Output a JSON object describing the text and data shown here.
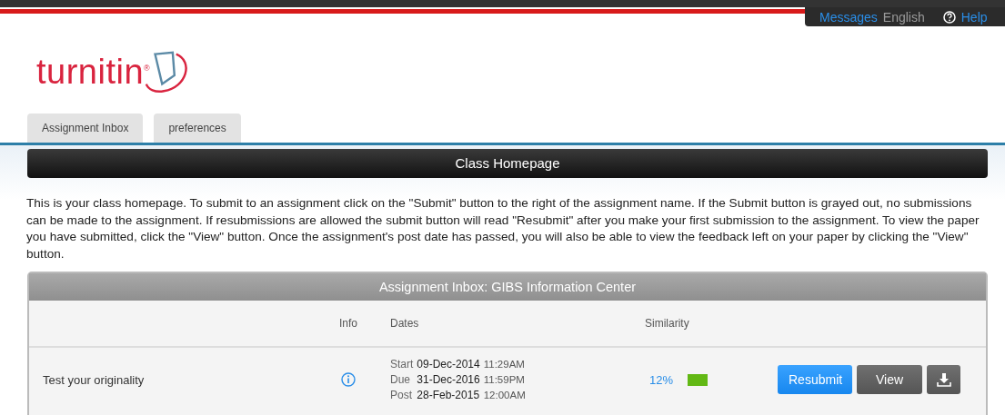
{
  "top_bar": {
    "links": [
      {
        "label": "Messages",
        "kind": "link"
      },
      {
        "label": "English",
        "kind": "text"
      },
      {
        "label": "Help",
        "kind": "help"
      }
    ]
  },
  "logo": {
    "text": "turnitin",
    "mark": "®"
  },
  "tabs": [
    {
      "label": "Assignment Inbox",
      "selected": false
    },
    {
      "label": "preferences",
      "selected": false
    }
  ],
  "page_title": "Class Homepage",
  "intro": "This is your class homepage. To submit to an assignment click on the \"Submit\" button to the right of the assignment name. If the Submit button is grayed out, no submissions can be made to the assignment. If resubmissions are allowed the submit button will read \"Resubmit\" after you make your first submission to the assignment. To view the paper you have submitted, click the \"View\" button. Once the assignment's post date has passed, you will also be able to view the feedback left on your paper by clicking the \"View\" button.",
  "inbox": {
    "title": "Assignment Inbox: GIBS Information Center",
    "columns": [
      "Info",
      "Dates",
      "Similarity"
    ],
    "rows": [
      {
        "name": "Test your originality",
        "dates": [
          {
            "label": "Start",
            "date": "09-Dec-2014",
            "time": "11:29AM"
          },
          {
            "label": "Due",
            "date": "31-Dec-2016",
            "time": "11:59PM"
          },
          {
            "label": "Post",
            "date": "28-Feb-2015",
            "time": "12:00AM"
          }
        ],
        "similarity": "12%",
        "color": "#62b814",
        "buttons": [
          {
            "label": "Resubmit",
            "kind": "primary"
          },
          {
            "label": "View",
            "kind": "secondary"
          },
          {
            "kind": "download"
          }
        ]
      }
    ]
  }
}
